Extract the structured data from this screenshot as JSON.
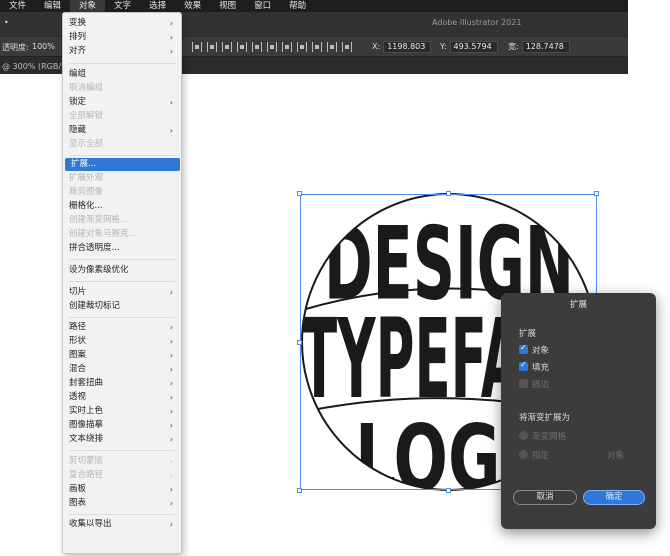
{
  "menubar": {
    "items": [
      "文件",
      "编辑",
      "对象",
      "文字",
      "选择",
      "效果",
      "视图",
      "窗口",
      "帮助"
    ],
    "active_index": 2
  },
  "titlebar": {
    "app_title": "Adobe Illustrator 2021",
    "left_text": "•"
  },
  "controlbar": {
    "opacity_label": "透明度:",
    "opacity_value": "100%",
    "x_label": "X:",
    "x_value": "1198.803",
    "y_label": "Y:",
    "y_value": "493.5794",
    "w_label": "宽:",
    "w_value": "128.7478"
  },
  "docbar": {
    "tab_text": "@ 300% (RGB/预览)"
  },
  "object_menu": {
    "items": [
      {
        "label": "变换",
        "disabled": false,
        "submenu": true
      },
      {
        "label": "排列",
        "disabled": false,
        "submenu": true
      },
      {
        "label": "对齐",
        "disabled": false,
        "submenu": true
      },
      {
        "label": "编组",
        "disabled": false,
        "submenu": false
      },
      {
        "label": "取消编组",
        "disabled": true,
        "submenu": false
      },
      {
        "label": "锁定",
        "disabled": false,
        "submenu": true
      },
      {
        "label": "全部解锁",
        "disabled": true,
        "submenu": false
      },
      {
        "label": "隐藏",
        "disabled": false,
        "submenu": true
      },
      {
        "label": "显示全部",
        "disabled": true,
        "submenu": false
      },
      {
        "label": "扩展...",
        "disabled": false,
        "submenu": false,
        "highlight": true
      },
      {
        "label": "扩展外观",
        "disabled": true,
        "submenu": false
      },
      {
        "label": "裁剪图像",
        "disabled": true,
        "submenu": false
      },
      {
        "label": "栅格化...",
        "disabled": false,
        "submenu": false
      },
      {
        "label": "创建渐变网格...",
        "disabled": true,
        "submenu": false
      },
      {
        "label": "创建对象马赛克...",
        "disabled": true,
        "submenu": false
      },
      {
        "label": "拼合透明度...",
        "disabled": false,
        "submenu": false
      },
      {
        "label": "设为像素级优化",
        "disabled": false,
        "submenu": false
      },
      {
        "label": "切片",
        "disabled": false,
        "submenu": true
      },
      {
        "label": "创建裁切标记",
        "disabled": false,
        "submenu": false
      },
      {
        "label": "路径",
        "disabled": false,
        "submenu": true
      },
      {
        "label": "形状",
        "disabled": false,
        "submenu": true
      },
      {
        "label": "图案",
        "disabled": false,
        "submenu": true
      },
      {
        "label": "混合",
        "disabled": false,
        "submenu": true
      },
      {
        "label": "封套扭曲",
        "disabled": false,
        "submenu": true
      },
      {
        "label": "透视",
        "disabled": false,
        "submenu": true
      },
      {
        "label": "实时上色",
        "disabled": false,
        "submenu": true
      },
      {
        "label": "图像描摹",
        "disabled": false,
        "submenu": true
      },
      {
        "label": "文本绕排",
        "disabled": false,
        "submenu": true
      },
      {
        "label": "剪切蒙版",
        "disabled": true,
        "submenu": true
      },
      {
        "label": "复合路径",
        "disabled": true,
        "submenu": true
      },
      {
        "label": "画板",
        "disabled": false,
        "submenu": true
      },
      {
        "label": "图表",
        "disabled": false,
        "submenu": true
      },
      {
        "label": "收集以导出",
        "disabled": false,
        "submenu": true
      }
    ],
    "shortcut_icon": "chevron-right-icon"
  },
  "artwork": {
    "line1": "DESIGN",
    "line2": "TYPEFACE",
    "line3": "LOGO",
    "fill_color": "#1a1a1a",
    "selection_color": "#4a8ef0"
  },
  "expand_dialog": {
    "title": "扩展",
    "section_expand": "扩展",
    "object_label": "对象",
    "object_checked": true,
    "fill_label": "填充",
    "fill_checked": true,
    "stroke_label": "描边",
    "stroke_disabled": true,
    "gradient_section": "将渐变扩展为",
    "gradient_mesh_label": "渐变网格",
    "specify_label": "指定",
    "specify_value": "对象",
    "cancel_label": "取消",
    "ok_label": "确定",
    "accent_color": "#2f78d6"
  }
}
